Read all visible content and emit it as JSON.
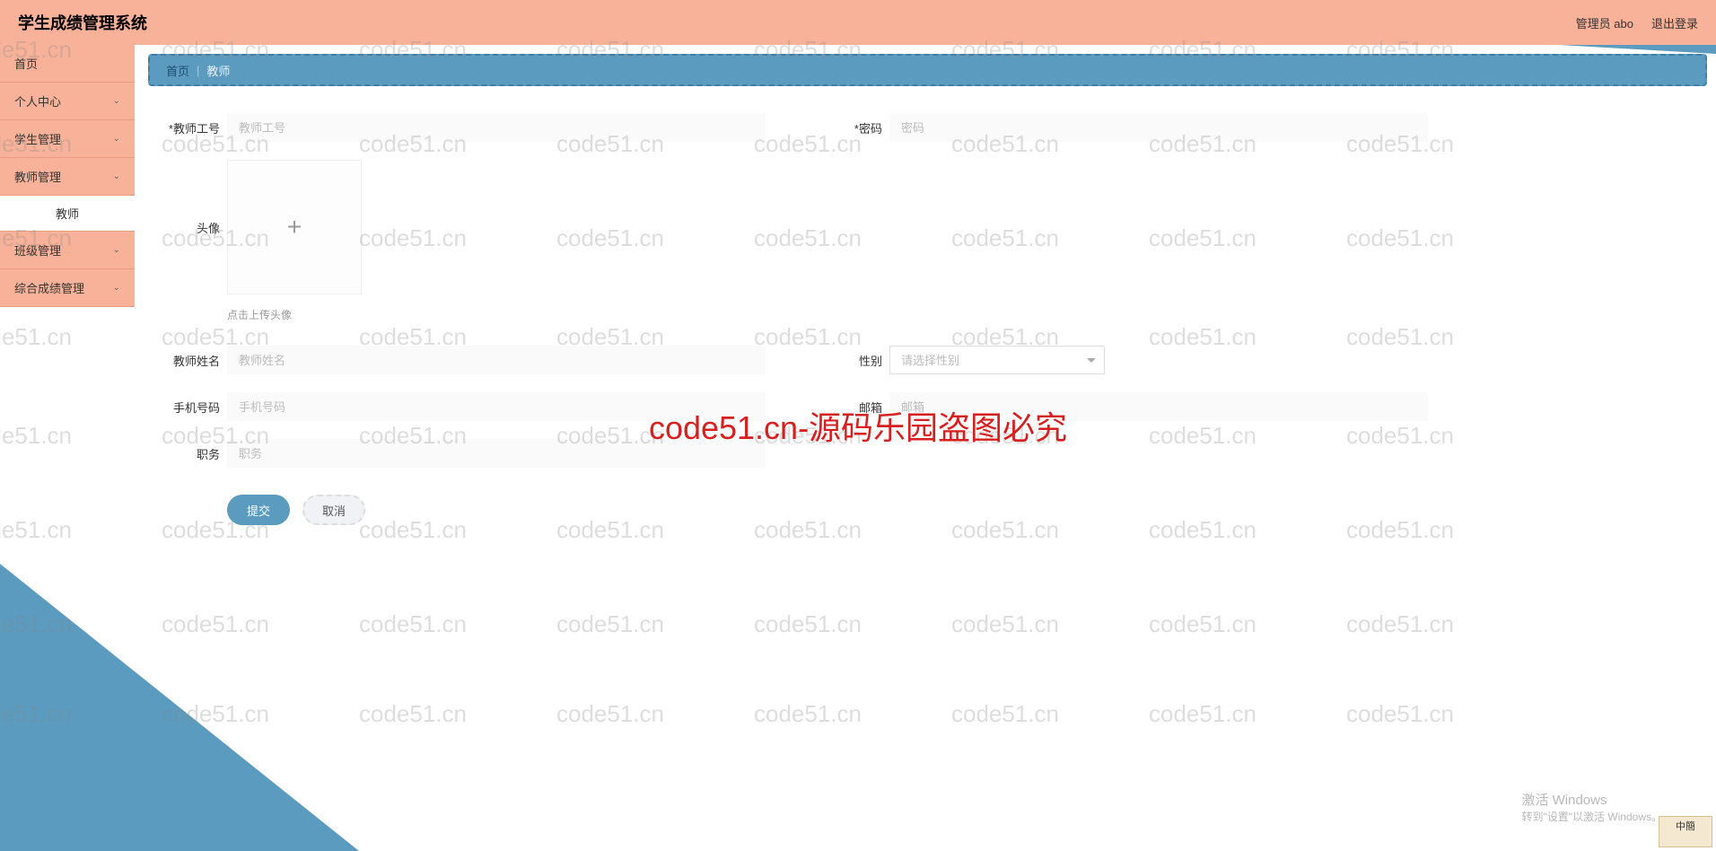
{
  "header": {
    "title": "学生成绩管理系统",
    "user_label": "管理员 abo",
    "logout_label": "退出登录"
  },
  "sidebar": {
    "items": [
      {
        "label": "首页",
        "expandable": false
      },
      {
        "label": "个人中心",
        "expandable": true
      },
      {
        "label": "学生管理",
        "expandable": true
      },
      {
        "label": "教师管理",
        "expandable": true,
        "children": [
          {
            "label": "教师"
          }
        ]
      },
      {
        "label": "班级管理",
        "expandable": true
      },
      {
        "label": "综合成绩管理",
        "expandable": true
      }
    ]
  },
  "breadcrumb": {
    "home": "首页",
    "current": "教师"
  },
  "form": {
    "teacher_no": {
      "label": "教师工号",
      "placeholder": "教师工号"
    },
    "password": {
      "label": "密码",
      "placeholder": "密码"
    },
    "avatar": {
      "label": "头像",
      "hint": "点击上传头像"
    },
    "teacher_name": {
      "label": "教师姓名",
      "placeholder": "教师姓名"
    },
    "gender": {
      "label": "性别",
      "placeholder": "请选择性别"
    },
    "phone": {
      "label": "手机号码",
      "placeholder": "手机号码"
    },
    "email": {
      "label": "邮箱",
      "placeholder": "邮箱"
    },
    "position": {
      "label": "职务",
      "placeholder": "职务"
    }
  },
  "buttons": {
    "submit": "提交",
    "cancel": "取消"
  },
  "watermark": {
    "text": "code51.cn",
    "main": "code51.cn-源码乐园盗图必究"
  },
  "windows": {
    "title": "激活 Windows",
    "sub": "转到\"设置\"以激活 Windows。"
  },
  "ime": "中簡"
}
